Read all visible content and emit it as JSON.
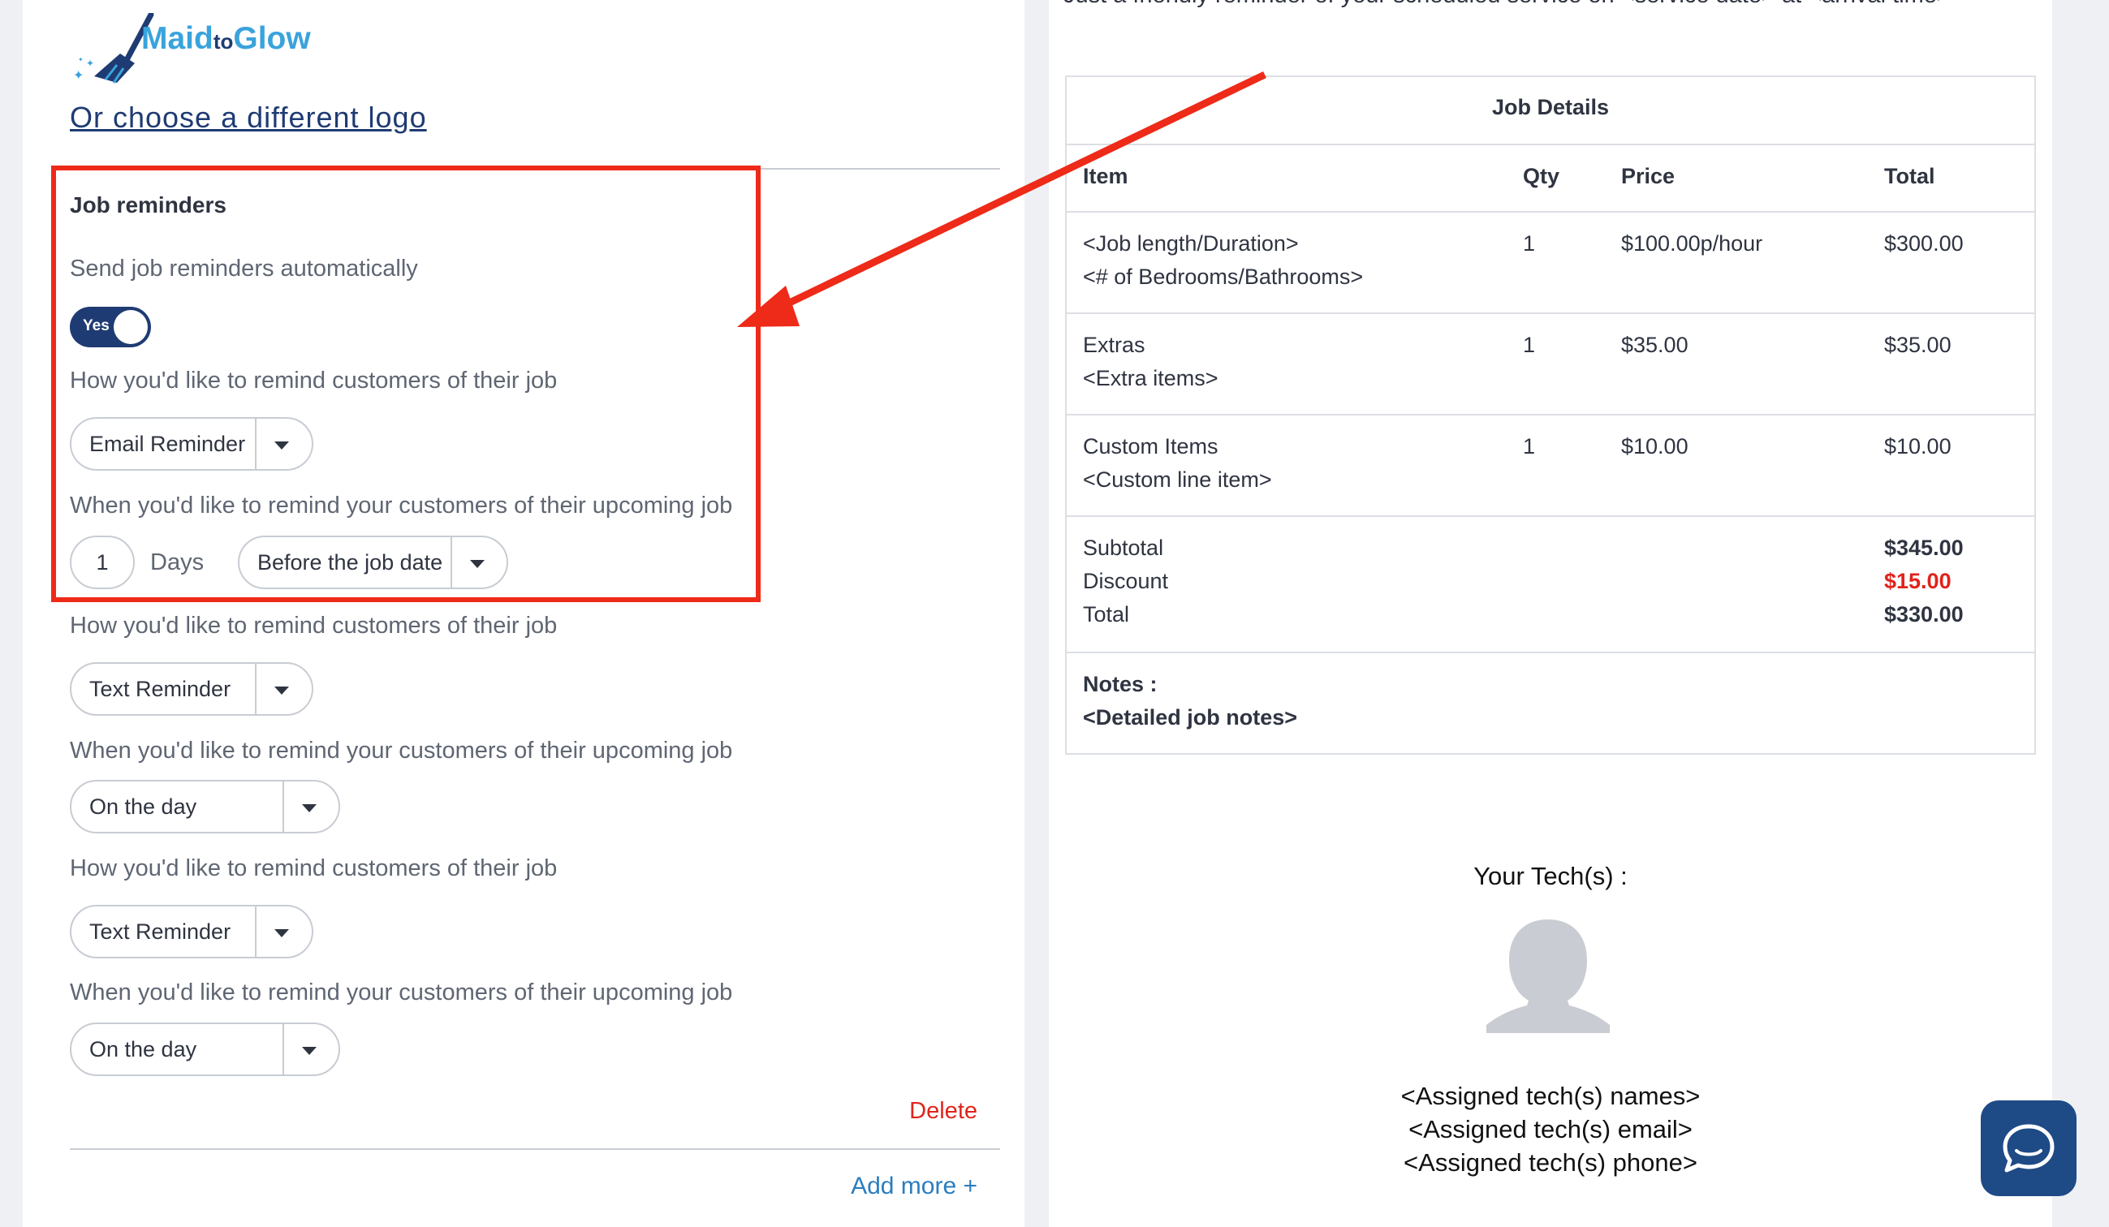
{
  "logo": {
    "text_main": "Maid",
    "text_to": "to",
    "text_end": "Glow"
  },
  "choose_logo_link": "Or choose a different logo",
  "job_reminders": {
    "title": "Job reminders",
    "auto_label": "Send job reminders automatically",
    "toggle_label": "Yes",
    "reminders": [
      {
        "method_label": "How you'd like to remind customers of their job",
        "method": "Email Reminder",
        "timing_label": "When you'd like to remind your customers of their upcoming job",
        "days": "1",
        "days_unit": "Days",
        "timing": "Before the job date"
      },
      {
        "method_label": "How you'd like to remind customers of their job",
        "method": "Text Reminder",
        "timing_label": "When you'd like to remind your customers of their upcoming job",
        "timing": "On the day"
      },
      {
        "method_label": "How you'd like to remind customers of their job",
        "method": "Text Reminder",
        "timing_label": "When you'd like to remind your customers of their upcoming job",
        "timing": "On the day"
      }
    ],
    "delete_label": "Delete",
    "add_more_label": "Add more +"
  },
  "preview": {
    "reminder_text": "Just a friendly reminder of your scheduled service on <service date> at <arrival time>",
    "table_title": "Job Details",
    "headers": [
      "Item",
      "Qty",
      "Price",
      "Total"
    ],
    "rows": [
      {
        "item1": "<Job length/Duration>",
        "item2": "<# of Bedrooms/Bathrooms>",
        "qty": "1",
        "price": "$100.00p/hour",
        "total": "$300.00"
      },
      {
        "item1": "Extras",
        "item2": "<Extra items>",
        "qty": "1",
        "price": "$35.00",
        "total": "$35.00"
      },
      {
        "item1": "Custom Items",
        "item2": "<Custom line item>",
        "qty": "1",
        "price": "$10.00",
        "total": "$10.00"
      }
    ],
    "summary": {
      "subtotal_label": "Subtotal",
      "subtotal": "$345.00",
      "discount_label": "Discount",
      "discount": "$15.00",
      "total_label": "Total",
      "total": "$330.00"
    },
    "notes_label": "Notes :",
    "notes_value": "<Detailed job notes>",
    "tech_title": "Your Tech(s) :",
    "tech_names": "<Assigned tech(s) names>",
    "tech_email": "<Assigned tech(s) email>",
    "tech_phone": "<Assigned tech(s) phone>"
  },
  "colors": {
    "brand_navy": "#1f3b73",
    "brand_blue": "#3aa3dc",
    "accent_red": "#ee2a18",
    "delete_red": "#e0241b",
    "link_blue": "#2a7dbf"
  },
  "icons": {
    "logo": "broom-icon",
    "dropdown": "caret-down-icon",
    "avatar": "user-silhouette-icon",
    "chat": "chat-bubble-icon"
  }
}
